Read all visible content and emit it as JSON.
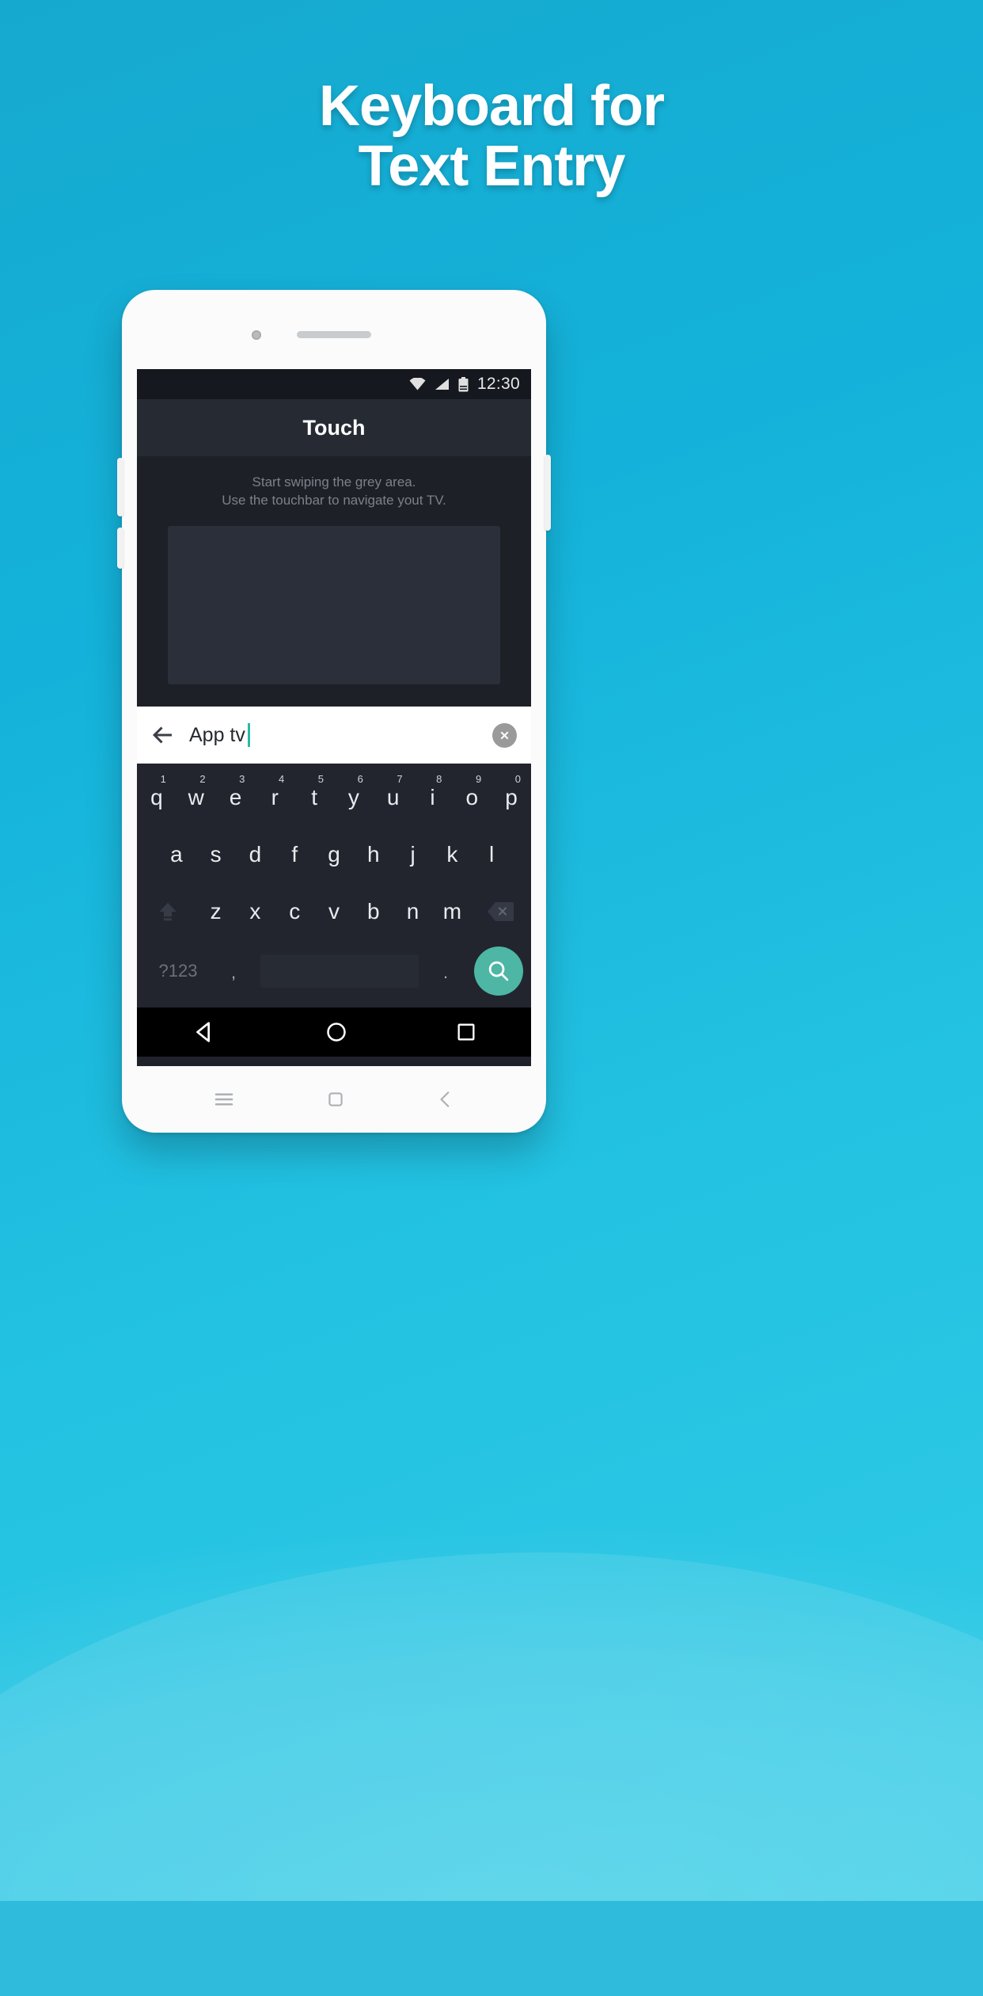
{
  "promo": {
    "headline_line1": "Keyboard for",
    "headline_line2": "Text Entry",
    "background_color": "#17b4d8",
    "headline_color": "#ffffff"
  },
  "phone": {
    "status_bar": {
      "time": "12:30",
      "icons": [
        "wifi-icon",
        "signal-icon",
        "battery-icon"
      ]
    },
    "app_bar": {
      "title": "Touch"
    },
    "content": {
      "hint_line1": "Start swiping the grey area.",
      "hint_line2": "Use the touchbar to navigate yout TV.",
      "touchpad_label": "touchpad-area"
    },
    "search": {
      "value": "App tv",
      "placeholder": "",
      "back_icon": "back-arrow-icon",
      "clear_icon": "clear-circle-icon",
      "caret_color": "#2bb9a8"
    },
    "keyboard": {
      "accent_color": "#4db6a4",
      "row1": [
        {
          "letter": "q",
          "num": "1"
        },
        {
          "letter": "w",
          "num": "2"
        },
        {
          "letter": "e",
          "num": "3"
        },
        {
          "letter": "r",
          "num": "4"
        },
        {
          "letter": "t",
          "num": "5"
        },
        {
          "letter": "y",
          "num": "6"
        },
        {
          "letter": "u",
          "num": "7"
        },
        {
          "letter": "i",
          "num": "8"
        },
        {
          "letter": "o",
          "num": "9"
        },
        {
          "letter": "p",
          "num": "0"
        }
      ],
      "row2": [
        "a",
        "s",
        "d",
        "f",
        "g",
        "h",
        "j",
        "k",
        "l"
      ],
      "row3": [
        "z",
        "x",
        "c",
        "v",
        "b",
        "n",
        "m"
      ],
      "shift_key": "shift-icon",
      "delete_key": "backspace-icon",
      "symbols_key": "?123",
      "comma_key": ",",
      "period_key": ".",
      "space_key": "",
      "action_key": "search-icon"
    },
    "nav_bar": {
      "back": "nav-back-icon",
      "home": "nav-home-icon",
      "recents": "nav-recents-icon"
    },
    "chin": {
      "menu": "menu-icon",
      "home": "home-square-icon",
      "back": "back-chevron-icon"
    }
  }
}
